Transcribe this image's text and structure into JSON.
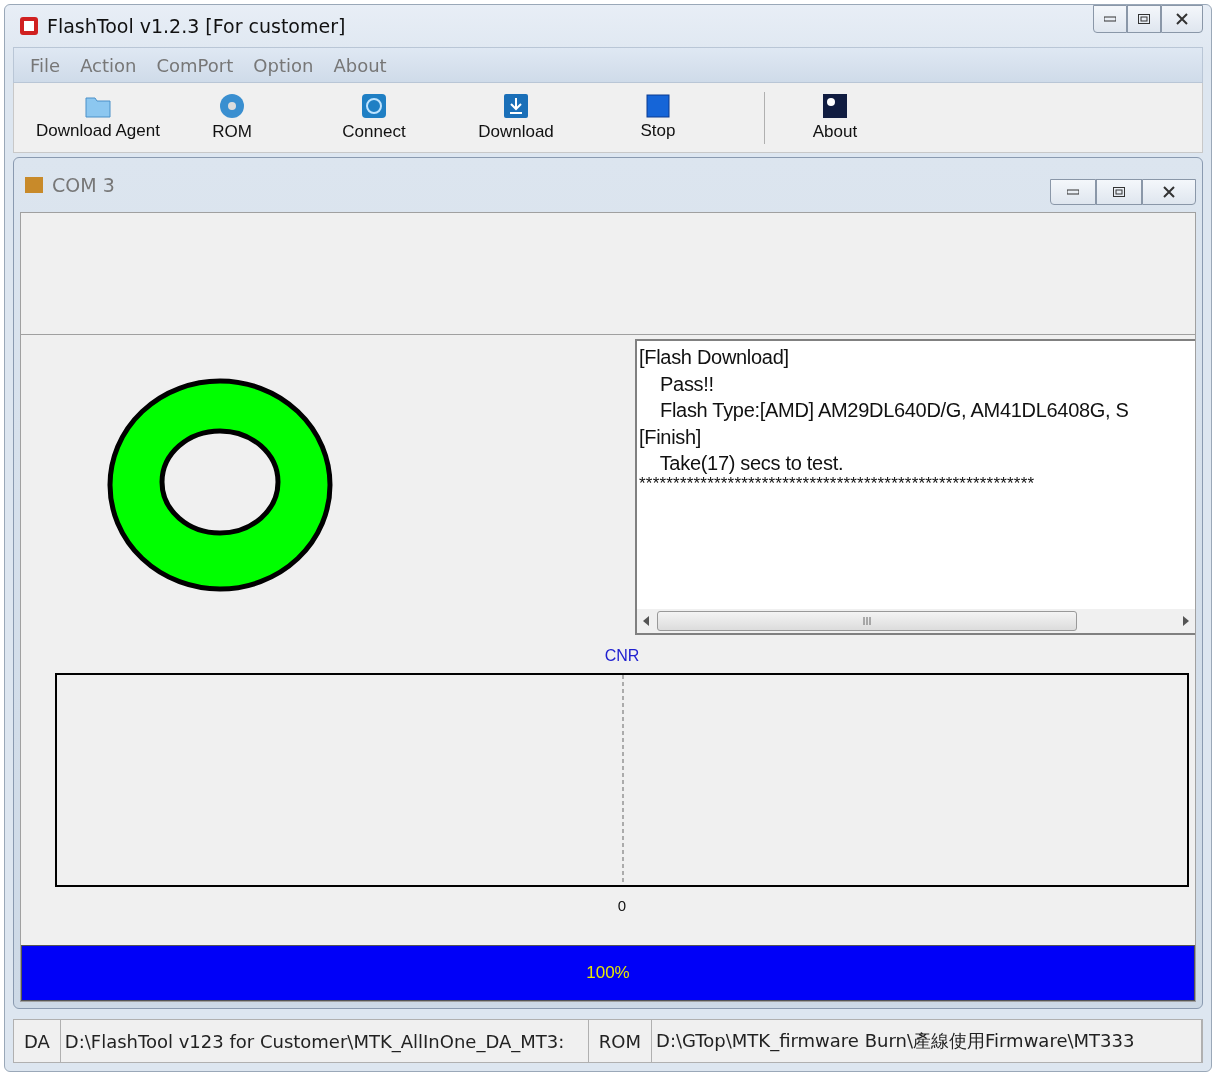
{
  "window": {
    "title": "FlashTool v1.2.3 [For customer]"
  },
  "menu": [
    "File",
    "Action",
    "ComPort",
    "Option",
    "About"
  ],
  "toolbar": [
    {
      "label": "Download Agent",
      "kind": "folder"
    },
    {
      "label": "ROM",
      "kind": "disc"
    },
    {
      "label": "Connect",
      "kind": "connect"
    },
    {
      "label": "Download",
      "kind": "download"
    },
    {
      "label": "Stop",
      "kind": "stop"
    },
    {
      "label": "About",
      "kind": "about"
    }
  ],
  "child_window": {
    "title": "COM 3"
  },
  "log": [
    "[Flash Download]",
    "    Pass!!",
    "    Flash Type:[AMD] AM29DL640D/G, AM41DL6408G, S",
    "[Finish]",
    "    Take(17) secs to test.",
    "**********************************************************"
  ],
  "chart": {
    "title": "CNR",
    "xtick": "0"
  },
  "progress": {
    "level": 1,
    "reading": "100%"
  },
  "status_bar": [
    {
      "text": "DA",
      "kind": "label"
    },
    {
      "text": "D:\\FlashTool v123 for Customer\\MTK_AllInOne_DA_MT3:",
      "kind": "path"
    },
    {
      "text": "ROM",
      "kind": "label"
    },
    {
      "text": "D:\\GTop\\MTK_firmware Burn\\產線使用Firmware\\MT333",
      "kind": "path"
    }
  ]
}
